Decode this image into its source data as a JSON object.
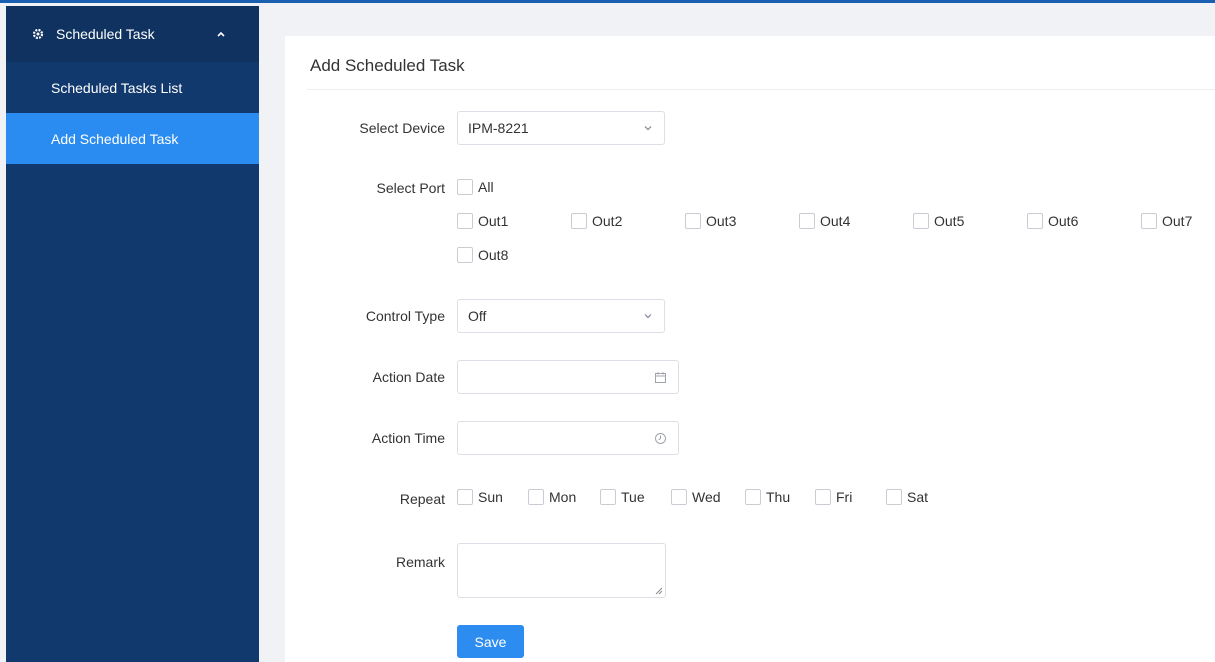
{
  "sidebar": {
    "header_label": "Scheduled Task",
    "header_icon": "gear-icon",
    "items": [
      {
        "label": "Scheduled Tasks List",
        "active": false
      },
      {
        "label": "Add Scheduled Task",
        "active": true
      }
    ]
  },
  "form": {
    "title": "Add Scheduled Task",
    "select_device": {
      "label": "Select Device",
      "value": "IPM-8221"
    },
    "select_port": {
      "label": "Select Port",
      "all_label": "All",
      "ports": [
        "Out1",
        "Out2",
        "Out3",
        "Out4",
        "Out5",
        "Out6",
        "Out7",
        "Out8"
      ]
    },
    "control_type": {
      "label": "Control Type",
      "value": "Off"
    },
    "action_date": {
      "label": "Action Date",
      "value": "",
      "icon": "calendar-icon"
    },
    "action_time": {
      "label": "Action Time",
      "value": "",
      "icon": "clock-icon"
    },
    "repeat": {
      "label": "Repeat",
      "days": [
        "Sun",
        "Mon",
        "Tue",
        "Wed",
        "Thu",
        "Fri",
        "Sat"
      ]
    },
    "remark": {
      "label": "Remark",
      "value": ""
    },
    "save_label": "Save"
  },
  "colors": {
    "sidebar_bg": "#12396e",
    "sidebar_active": "#2a8cf0",
    "primary_button": "#2d8cf0"
  }
}
